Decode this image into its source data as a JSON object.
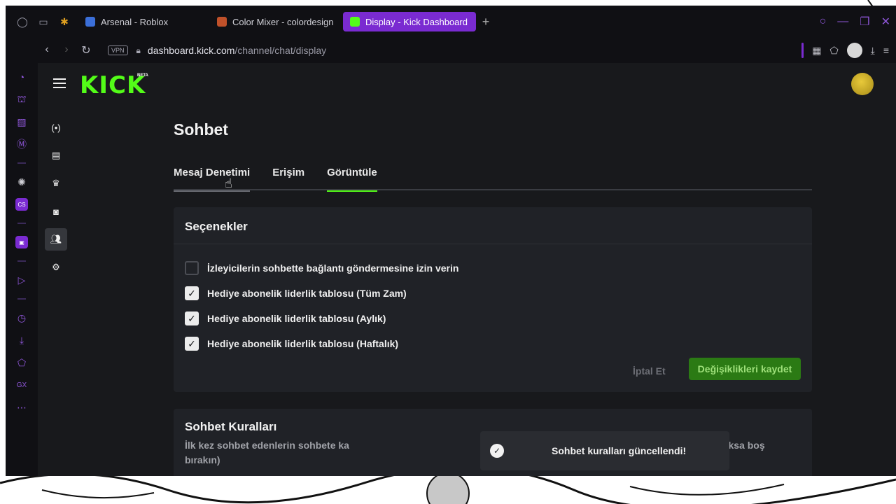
{
  "browser": {
    "tabs": [
      {
        "title": "Arsenal - Roblox",
        "favicon_color": "#3b6fd9"
      },
      {
        "title": "Color Mixer - colordesign",
        "favicon_color": "#c0512a"
      },
      {
        "title": "Display - Kick Dashboard",
        "favicon_color": "#53fc18"
      }
    ],
    "new_tab_glyph": "+",
    "url_host": "dashboard.kick.com",
    "url_path": "/channel/chat/display",
    "vpn_label": "VPN",
    "accent": "#7a2bd1"
  },
  "kick": {
    "logo_text": "KICK",
    "logo_badge": "BETA",
    "brand_color": "#53fc18",
    "page_title": "Sohbet",
    "tabs": [
      {
        "label": "Mesaj Denetimi",
        "state": "hover"
      },
      {
        "label": "Erişim",
        "state": "normal"
      },
      {
        "label": "Görüntüle",
        "state": "active"
      }
    ],
    "options_card": {
      "title": "Seçenekler",
      "items": [
        {
          "label": "İzleyicilerin sohbette bağlantı göndermesine izin verin",
          "checked": false
        },
        {
          "label": "Hediye abonelik liderlik tablosu (Tüm Zam)",
          "checked": true
        },
        {
          "label": "Hediye abonelik liderlik tablosu (Aylık)",
          "checked": true
        },
        {
          "label": "Hediye abonelik liderlik tablosu (Haftalık)",
          "checked": true
        }
      ],
      "cancel_label": "İptal Et",
      "save_label": "Değişiklikleri kaydet"
    },
    "rules_card": {
      "title": "Sohbet Kuralları",
      "description": "İlk kez sohbet edenlerin sohbete ka                                                                    eri gerekecektir. (görüntülenecek kural yoksa boş bırakın)"
    },
    "toast": {
      "message": "Sohbet kuralları güncellendi!"
    }
  }
}
